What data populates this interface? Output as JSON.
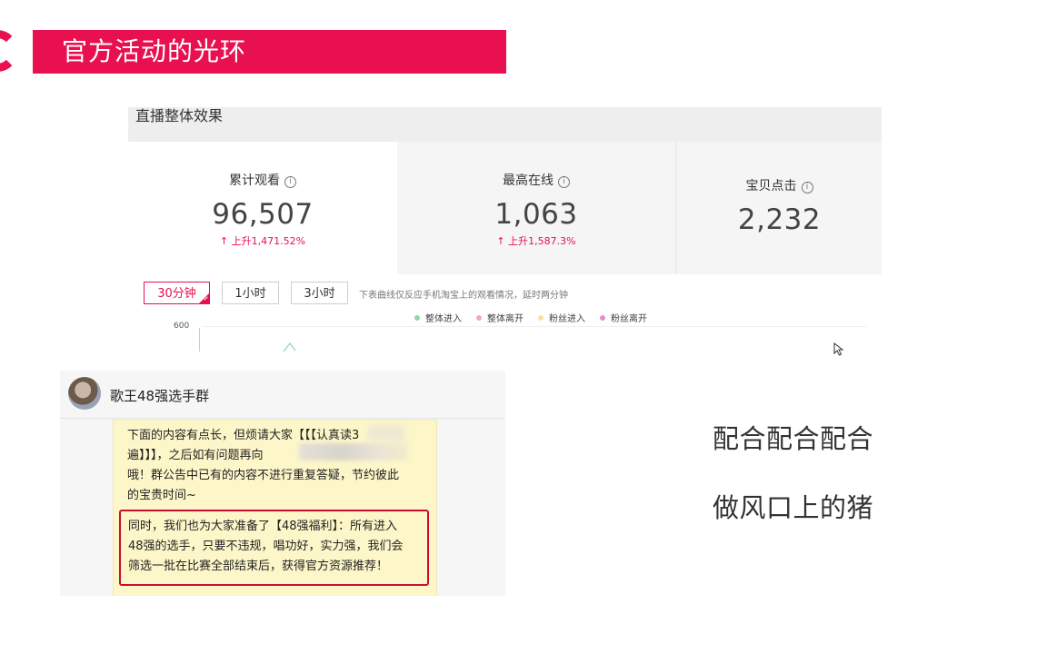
{
  "slide": {
    "title": "官方活动的光环"
  },
  "dashboard": {
    "header": "直播整体效果",
    "stats": [
      {
        "label": "累计观看",
        "value": "96,507",
        "change": "↑ 上升1,471.52%"
      },
      {
        "label": "最高在线",
        "value": "1,063",
        "change": "↑ 上升1,587.3%"
      },
      {
        "label": "宝贝点击",
        "value": "2,232"
      }
    ],
    "info_icon": "i",
    "time_buttons": [
      "30分钟",
      "1小时",
      "3小时"
    ],
    "active_button": "30分钟",
    "chart_note": "下表曲线仅反应手机淘宝上的观看情况，延时两分钟",
    "legend": [
      {
        "label": "整体进入",
        "color": "#8fd8a8"
      },
      {
        "label": "整体离开",
        "color": "#f2a9b8"
      },
      {
        "label": "粉丝进入",
        "color": "#f3e39a"
      },
      {
        "label": "粉丝离开",
        "color": "#e58fc8"
      }
    ],
    "y_tick": "600",
    "line_color": "#8fd8a8"
  },
  "chat": {
    "group_name": "歌王48强选手群",
    "message_lines": [
      "下面的内容有点长，但烦请大家【【【认真读3",
      "遍】】】，之后如有问题再向",
      "哦！群公告中已有的内容不进行重复答疑，节约彼此",
      "的宝贵时间~"
    ],
    "highlight_lines": [
      "同时，我们也为大家准备了【48强福利】：所有进入",
      "48强的选手，只要不违规，唱功好，实力强，我们会",
      "筛选一批在比赛全部结束后，获得官方资源推荐！"
    ]
  },
  "captions": [
    "配合配合配合",
    "做风口上的猪"
  ],
  "colors": {
    "accent": "#e8104f",
    "highlight_border": "#c8102e",
    "bubble": "#fdf6c9"
  }
}
